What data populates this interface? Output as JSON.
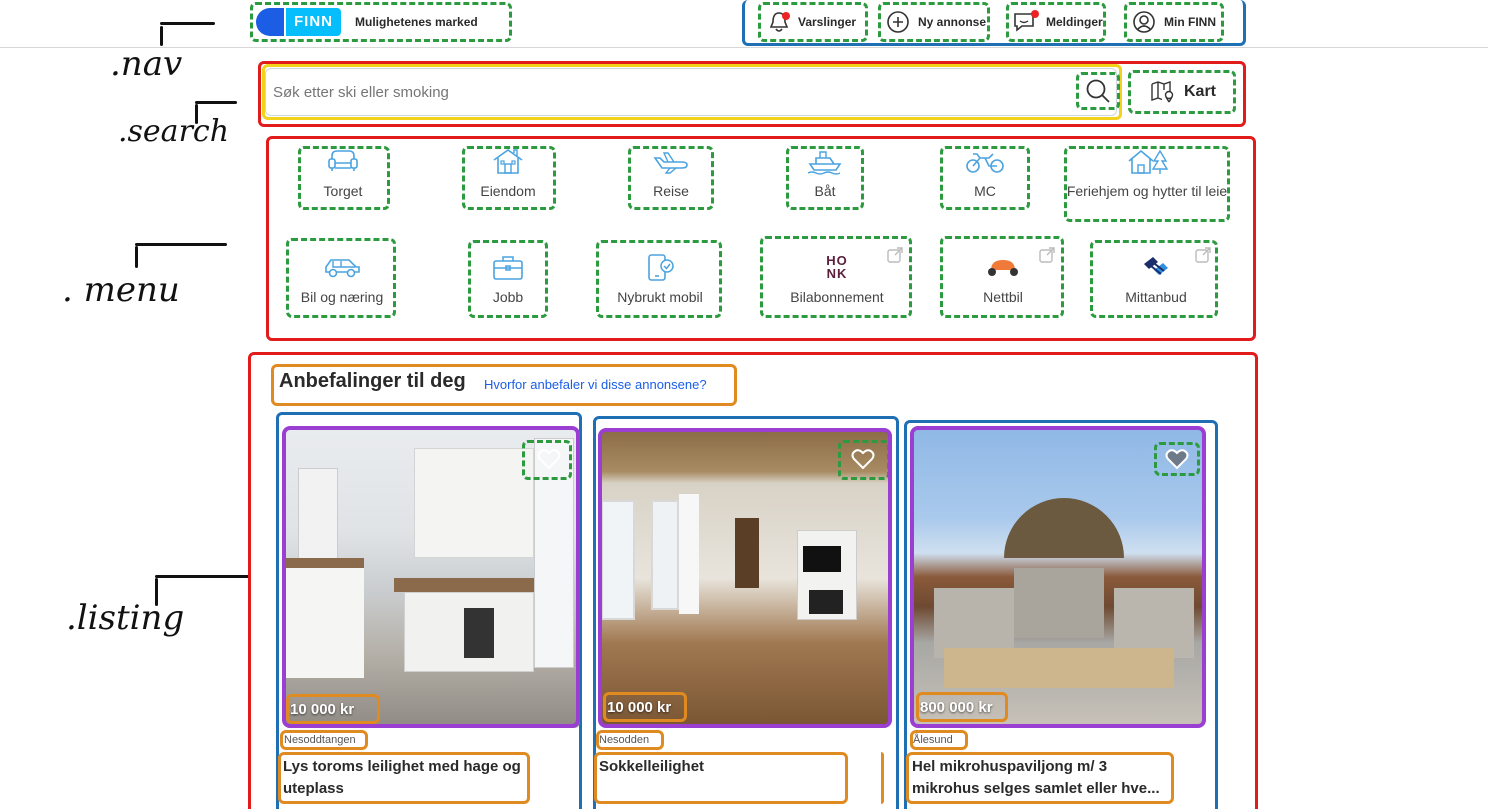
{
  "annotations": {
    "nav": ".nav",
    "search": ".search",
    "menu": ". menu",
    "listing": ".listing"
  },
  "nav": {
    "logo_text": "FINN",
    "tagline": "Mulighetenes marked",
    "items": [
      {
        "label": "Varslinger",
        "icon": "bell-icon"
      },
      {
        "label": "Ny annonse",
        "icon": "plus-circle-icon"
      },
      {
        "label": "Meldinger",
        "icon": "chat-icon"
      },
      {
        "label": "Min FINN",
        "icon": "user-circle-icon"
      }
    ]
  },
  "search": {
    "placeholder": "Søk etter ski eller smoking",
    "map_label": "Kart"
  },
  "menu": {
    "items": [
      {
        "label": "Torget",
        "icon": "sofa-icon"
      },
      {
        "label": "Eiendom",
        "icon": "house-icon"
      },
      {
        "label": "Reise",
        "icon": "plane-icon"
      },
      {
        "label": "Båt",
        "icon": "boat-icon"
      },
      {
        "label": "MC",
        "icon": "motorcycle-icon"
      },
      {
        "label": "Feriehjem og hytter til leie",
        "icon": "cabin-icon"
      },
      {
        "label": "Bil og næring",
        "icon": "car-icon"
      },
      {
        "label": "Jobb",
        "icon": "briefcase-icon"
      },
      {
        "label": "Nybrukt mobil",
        "icon": "phone-icon"
      },
      {
        "label": "Bilabonnement",
        "icon": "honk-logo",
        "logo_text": "HONK"
      },
      {
        "label": "Nettbil",
        "icon": "nettbil-logo"
      },
      {
        "label": "Mittanbud",
        "icon": "mittanbud-logo"
      }
    ]
  },
  "listing": {
    "title": "Anbefalinger til deg",
    "why_link": "Hvorfor anbefaler vi disse annonsene?",
    "cards": [
      {
        "price": "10 000 kr",
        "location": "Nesoddtangen",
        "title": "Lys toroms leilighet med hage og uteplass"
      },
      {
        "price": "10 000 kr",
        "location": "Nesodden",
        "title": "Sokkelleilighet"
      },
      {
        "price": "800 000 kr",
        "location": "Ålesund",
        "title": "Hel mikrohuspaviljong m/ 3 mikrohus selges samlet eller hve..."
      }
    ]
  },
  "colors": {
    "finn_blue": "#06befb",
    "finn_dark_blue": "#1b5ee5",
    "icon_blue": "#4aa3e0",
    "annotation_red": "#e21b1b",
    "annotation_green": "#2c9a3f",
    "annotation_orange": "#e08a22",
    "annotation_purple": "#9b3fd3",
    "annotation_blue": "#1f6fb5",
    "annotation_yellow": "#f3d21c"
  }
}
